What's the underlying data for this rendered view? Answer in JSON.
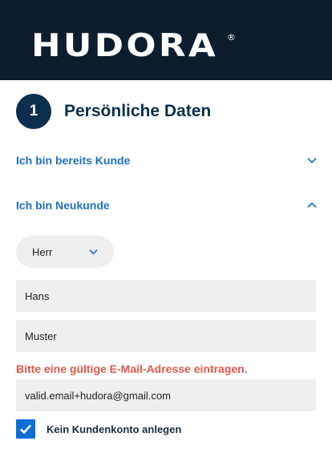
{
  "brand": {
    "logo_text": "HUDORA",
    "registered_mark": "®"
  },
  "step": {
    "number": "1",
    "title": "Persönliche Daten"
  },
  "accordion": {
    "existing_customer": {
      "label": "Ich bin bereits Kunde",
      "expanded": false,
      "icon": "chevron-down-icon"
    },
    "new_customer": {
      "label": "Ich bin Neukunde",
      "expanded": true,
      "icon": "chevron-up-icon"
    }
  },
  "form": {
    "salutation": {
      "value": "Herr"
    },
    "first_name": {
      "value": "Hans"
    },
    "last_name": {
      "value": "Muster"
    },
    "email_error": "Bitte eine gültige E-Mail-Adresse eintragen.",
    "email": {
      "value": "valid.email+hudora@gmail.com"
    },
    "no_account": {
      "label": "Kein Kundenkonto anlegen",
      "checked": true
    }
  },
  "colors": {
    "header_bg": "#0c1d2d",
    "step_circle": "#0c2f4d",
    "link_blue": "#1f6fc6",
    "error_red": "#e4574a",
    "checkbox_blue": "#0e6ed8",
    "field_bg": "#efefef"
  }
}
